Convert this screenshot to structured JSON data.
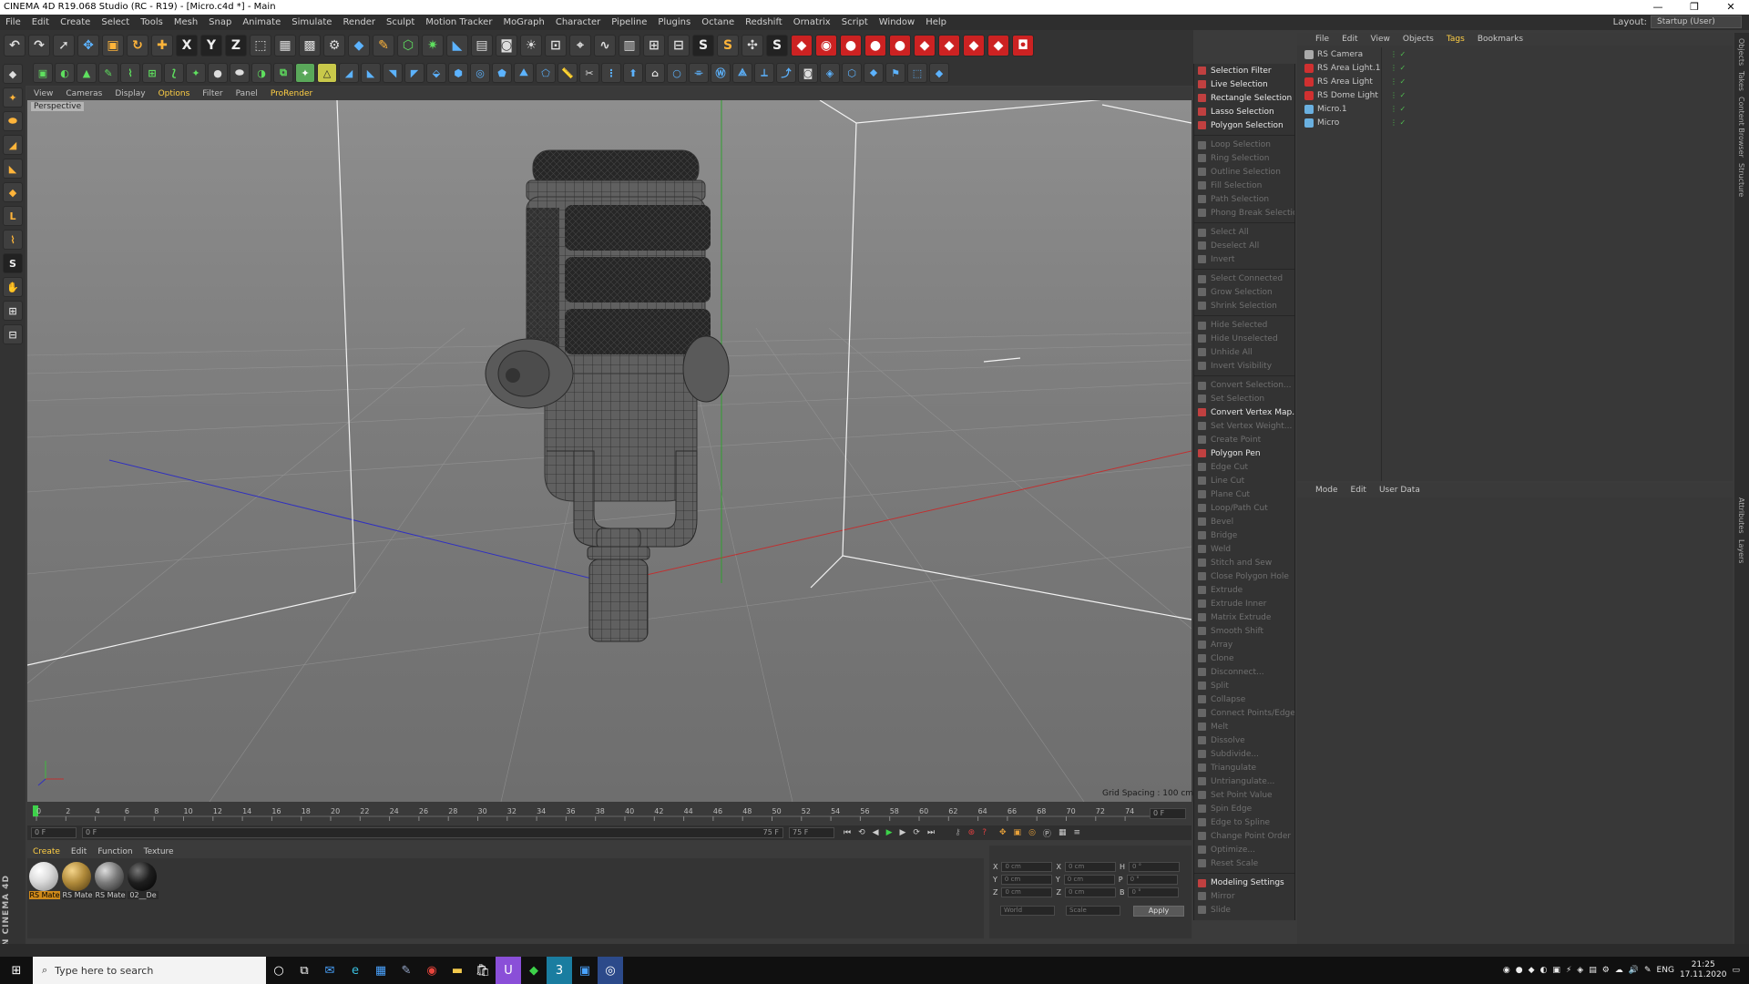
{
  "window": {
    "title": "CINEMA 4D R19.068 Studio (RC - R19) - [Micro.c4d *] - Main",
    "min": "—",
    "max": "❐",
    "close": "✕"
  },
  "menu": [
    "File",
    "Edit",
    "Create",
    "Select",
    "Tools",
    "Mesh",
    "Snap",
    "Animate",
    "Simulate",
    "Render",
    "Sculpt",
    "Motion Tracker",
    "MoGraph",
    "Character",
    "Pipeline",
    "Plugins",
    "Octane",
    "Redshift",
    "Ornatrix",
    "Script",
    "Window",
    "Help"
  ],
  "layout": {
    "label": "Layout:",
    "value": "Startup (User)"
  },
  "viewport": {
    "menu": [
      "View",
      "Cameras",
      "Display",
      "Options",
      "Filter",
      "Panel",
      "ProRender"
    ],
    "label": "Perspective",
    "grid_spacing": "Grid Spacing : 100 cm"
  },
  "timeline": {
    "ticks": [
      "0",
      "2",
      "4",
      "6",
      "8",
      "10",
      "12",
      "14",
      "16",
      "18",
      "20",
      "22",
      "24",
      "26",
      "28",
      "30",
      "32",
      "34",
      "36",
      "38",
      "40",
      "42",
      "44",
      "46",
      "48",
      "50",
      "52",
      "54",
      "56",
      "58",
      "60",
      "62",
      "64",
      "66",
      "68",
      "70",
      "72",
      "74"
    ],
    "current": "0 F",
    "start": "0 F",
    "range_start": "0 F",
    "range_end": "75 F",
    "end": "75 F"
  },
  "materials": {
    "menu": [
      "Create",
      "Edit",
      "Function",
      "Texture"
    ],
    "items": [
      {
        "label": "RS Mate",
        "color": "#e8e8e8",
        "selected": true
      },
      {
        "label": "RS Mate",
        "color": "#b08a3a",
        "selected": false
      },
      {
        "label": "RS Mate",
        "color": "#7a7a7a",
        "selected": false
      },
      {
        "label": "02__De",
        "color": "#1e1e1e",
        "selected": false
      }
    ]
  },
  "coords": {
    "rows": [
      {
        "a": "X",
        "v1": "0 cm",
        "b": "X",
        "v2": "0 cm",
        "c": "H",
        "v3": "0 °"
      },
      {
        "a": "Y",
        "v1": "0 cm",
        "b": "Y",
        "v2": "0 cm",
        "c": "P",
        "v3": "0 °"
      },
      {
        "a": "Z",
        "v1": "0 cm",
        "b": "Z",
        "v2": "0 cm",
        "c": "B",
        "v3": "0 °"
      }
    ],
    "world": "World",
    "scale": "Scale",
    "apply": "Apply"
  },
  "commands": [
    {
      "label": "Selection Filter",
      "enabled": true
    },
    {
      "label": "Live Selection",
      "enabled": true
    },
    {
      "label": "Rectangle Selection",
      "enabled": true
    },
    {
      "label": "Lasso Selection",
      "enabled": true
    },
    {
      "label": "Polygon Selection",
      "enabled": true
    },
    {
      "label": "Loop Selection",
      "enabled": false,
      "sep": true
    },
    {
      "label": "Ring Selection",
      "enabled": false
    },
    {
      "label": "Outline Selection",
      "enabled": false
    },
    {
      "label": "Fill Selection",
      "enabled": false
    },
    {
      "label": "Path Selection",
      "enabled": false
    },
    {
      "label": "Phong Break Selection",
      "enabled": false
    },
    {
      "label": "Select All",
      "enabled": false,
      "sep": true
    },
    {
      "label": "Deselect All",
      "enabled": false
    },
    {
      "label": "Invert",
      "enabled": false
    },
    {
      "label": "Select Connected",
      "enabled": false,
      "sep": true
    },
    {
      "label": "Grow Selection",
      "enabled": false
    },
    {
      "label": "Shrink Selection",
      "enabled": false
    },
    {
      "label": "Hide Selected",
      "enabled": false,
      "sep": true
    },
    {
      "label": "Hide Unselected",
      "enabled": false
    },
    {
      "label": "Unhide All",
      "enabled": false
    },
    {
      "label": "Invert Visibility",
      "enabled": false
    },
    {
      "label": "Convert Selection...",
      "enabled": false,
      "sep": true
    },
    {
      "label": "Set Selection",
      "enabled": false
    },
    {
      "label": "Convert Vertex Map...",
      "enabled": true
    },
    {
      "label": "Set Vertex Weight...",
      "enabled": false
    },
    {
      "label": "Create Point",
      "enabled": false
    },
    {
      "label": "Polygon Pen",
      "enabled": true
    },
    {
      "label": "Edge Cut",
      "enabled": false
    },
    {
      "label": "Line Cut",
      "enabled": false
    },
    {
      "label": "Plane Cut",
      "enabled": false
    },
    {
      "label": "Loop/Path Cut",
      "enabled": false
    },
    {
      "label": "Bevel",
      "enabled": false
    },
    {
      "label": "Bridge",
      "enabled": false
    },
    {
      "label": "Weld",
      "enabled": false
    },
    {
      "label": "Stitch and Sew",
      "enabled": false
    },
    {
      "label": "Close Polygon Hole",
      "enabled": false
    },
    {
      "label": "Extrude",
      "enabled": false
    },
    {
      "label": "Extrude Inner",
      "enabled": false
    },
    {
      "label": "Matrix Extrude",
      "enabled": false
    },
    {
      "label": "Smooth Shift",
      "enabled": false
    },
    {
      "label": "Array",
      "enabled": false
    },
    {
      "label": "Clone",
      "enabled": false
    },
    {
      "label": "Disconnect...",
      "enabled": false
    },
    {
      "label": "Split",
      "enabled": false
    },
    {
      "label": "Collapse",
      "enabled": false
    },
    {
      "label": "Connect Points/Edges",
      "enabled": false
    },
    {
      "label": "Melt",
      "enabled": false
    },
    {
      "label": "Dissolve",
      "enabled": false
    },
    {
      "label": "Subdivide...",
      "enabled": false
    },
    {
      "label": "Triangulate",
      "enabled": false
    },
    {
      "label": "Untriangulate...",
      "enabled": false
    },
    {
      "label": "Set Point Value",
      "enabled": false
    },
    {
      "label": "Spin Edge",
      "enabled": false
    },
    {
      "label": "Edge to Spline",
      "enabled": false
    },
    {
      "label": "Change Point Order",
      "enabled": false
    },
    {
      "label": "Optimize...",
      "enabled": false
    },
    {
      "label": "Reset Scale",
      "enabled": false
    },
    {
      "label": "Modeling Settings",
      "enabled": true,
      "sep": true
    },
    {
      "label": "Mirror",
      "enabled": false
    },
    {
      "label": "Slide",
      "enabled": false
    }
  ],
  "objects": {
    "menu": [
      "File",
      "Edit",
      "View",
      "Objects",
      "Tags",
      "Bookmarks"
    ],
    "rows": [
      {
        "name": "RS Camera",
        "color": "#aaaaaa"
      },
      {
        "name": "RS Area Light.1",
        "color": "#d03030"
      },
      {
        "name": "RS Area Light",
        "color": "#d03030"
      },
      {
        "name": "RS Dome Light",
        "color": "#d03030"
      },
      {
        "name": "Micro.1",
        "color": "#6ab0e0"
      },
      {
        "name": "Micro",
        "color": "#6ab0e0"
      }
    ]
  },
  "attributes": {
    "menu": [
      "Mode",
      "Edit",
      "User Data"
    ]
  },
  "right_tabs": [
    "Objects",
    "Takes",
    "Content Browser",
    "Structure",
    "Attributes",
    "Layers"
  ],
  "maxon": "MAXON CINEMA 4D",
  "taskbar": {
    "search_placeholder": "Type here to search",
    "lang": "ENG",
    "time": "21:25",
    "date": "17.11.2020"
  }
}
